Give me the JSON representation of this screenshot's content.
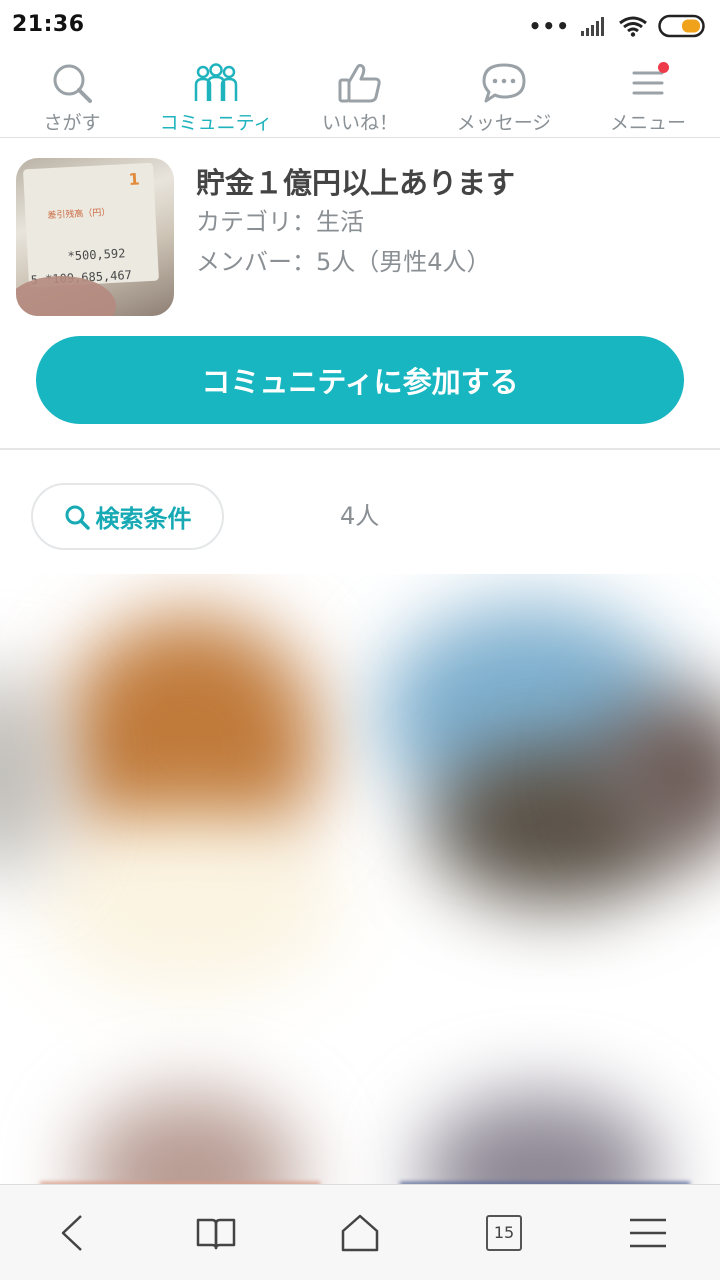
{
  "status_bar": {
    "time": "21:36",
    "dots": "•••",
    "signal_icon": "signal-icon",
    "wifi_icon": "wifi-icon",
    "battery_icon": "battery-icon"
  },
  "top_nav": {
    "items": [
      {
        "label": "さがす",
        "icon": "search-icon",
        "active": false
      },
      {
        "label": "コミュニティ",
        "icon": "community-icon",
        "active": true
      },
      {
        "label": "いいね！",
        "icon": "thumbs-up-icon",
        "active": false
      },
      {
        "label": "メッセージ",
        "icon": "message-icon",
        "active": false
      },
      {
        "label": "メニュー",
        "icon": "menu-icon",
        "active": false,
        "has_notification": true
      }
    ],
    "active_color": "#1fb3bd",
    "inactive_color": "#8a9196"
  },
  "community": {
    "thumbnail_receipt": {
      "number": "1",
      "header": "差引残高（円）",
      "line1": "*500,592",
      "line2": "5 *109,685,467"
    },
    "title": "貯金１億円以上あります",
    "category": "カテゴリ：生活",
    "members": "メンバー：5人（男性4人）",
    "join_label": "コミュニティに参加する",
    "accent_color": "#17b6c0"
  },
  "search": {
    "button_label": "検索条件",
    "result_count": "4人"
  },
  "bottom_bar": {
    "back_icon": "back-icon",
    "bookmarks_icon": "book-icon",
    "home_icon": "home-icon",
    "tab_count": "15",
    "menu_icon": "hamburger-icon"
  }
}
